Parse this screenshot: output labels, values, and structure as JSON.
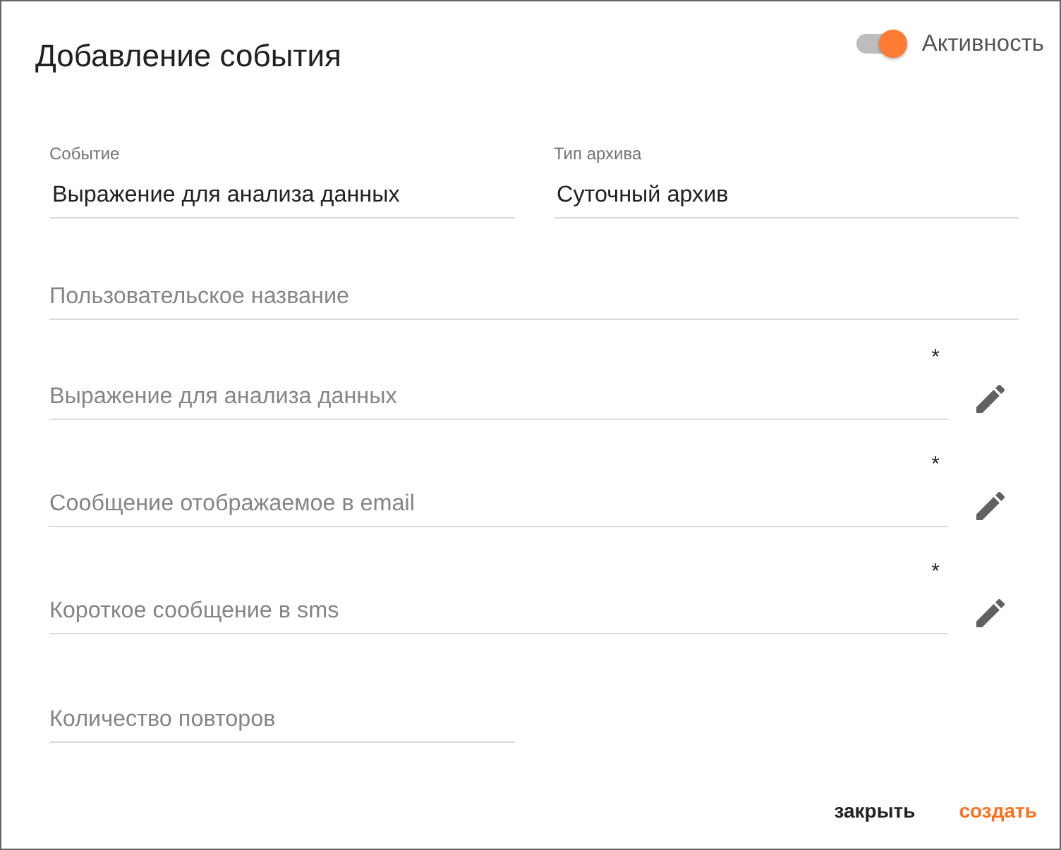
{
  "dialog": {
    "title": "Добавление события",
    "toggle": {
      "label": "Активность",
      "on": true
    }
  },
  "fields": [
    {
      "kind": "labeled",
      "label": "Событие",
      "value": "Выражение для анализа данных"
    },
    {
      "kind": "labeled",
      "label": "Тип архива",
      "value": "Суточный архив"
    },
    {
      "kind": "text",
      "placeholder": "Пользовательское название"
    },
    {
      "kind": "editor",
      "placeholder": "Выражение для анализа данных",
      "mark": "*"
    },
    {
      "kind": "editor",
      "placeholder": "Сообщение отображаемое в email",
      "mark": "*"
    },
    {
      "kind": "editor",
      "placeholder": "Короткое сообщение в sms",
      "mark": "*"
    },
    {
      "kind": "short",
      "placeholder": "Количество повторов"
    }
  ],
  "buttons": [
    {
      "kind": "plain",
      "label": "закрыть"
    },
    {
      "kind": "primary",
      "label": "создать"
    }
  ]
}
